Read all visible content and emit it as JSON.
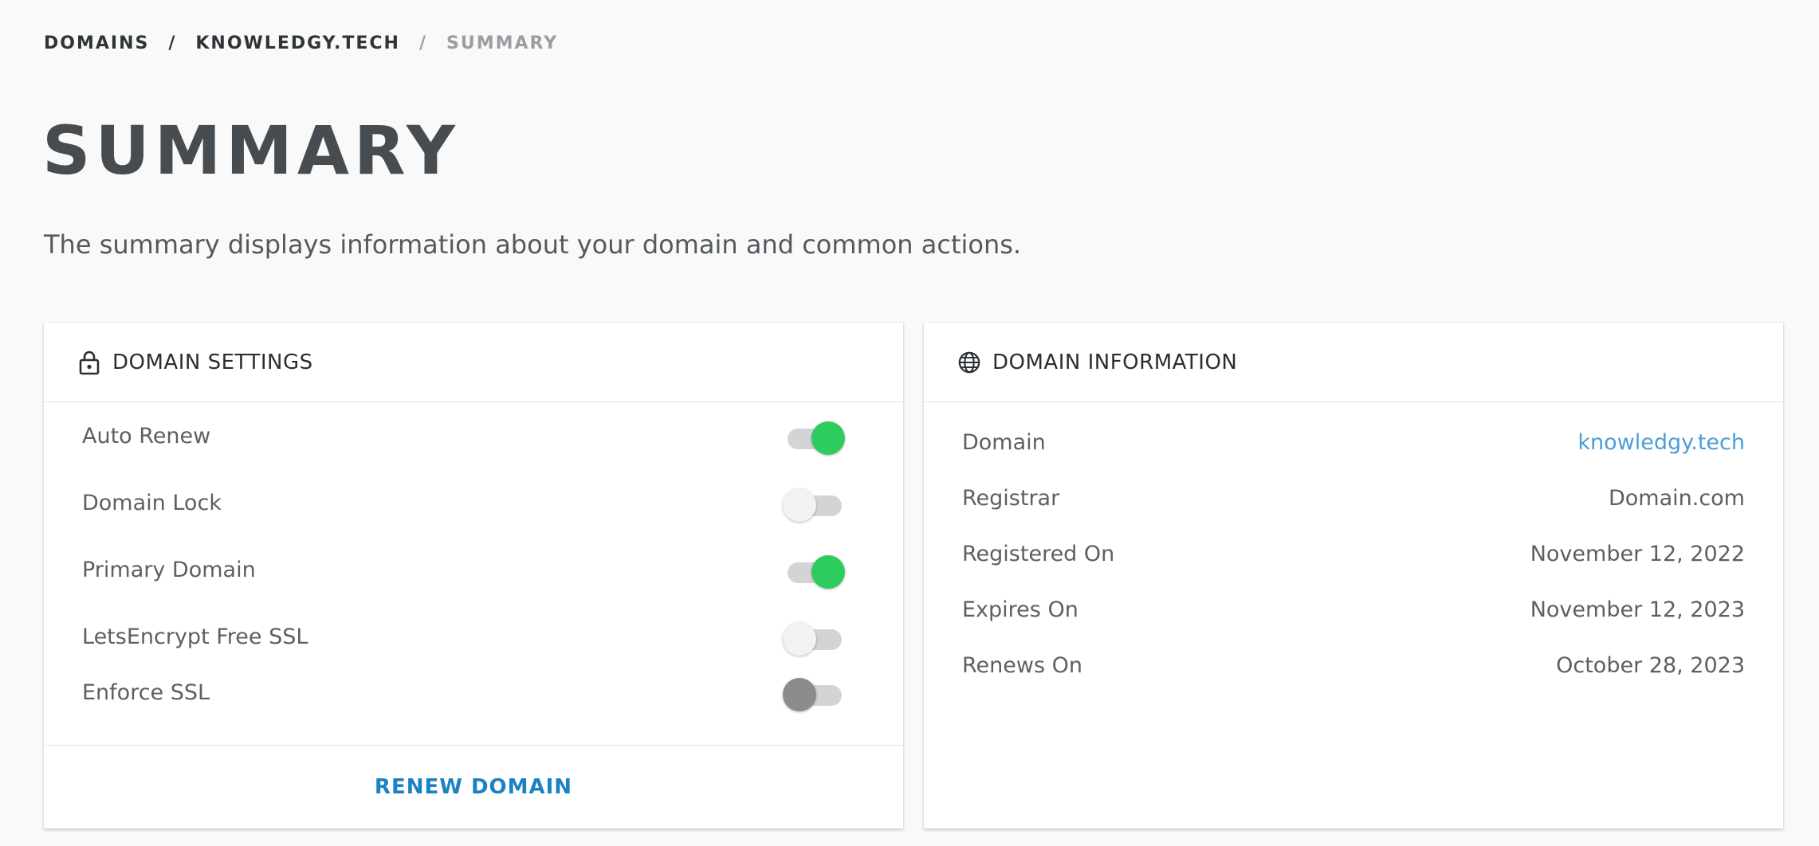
{
  "breadcrumb": {
    "items": [
      "DOMAINS",
      "KNOWLEDGY.TECH",
      "SUMMARY"
    ],
    "separator": "/"
  },
  "page": {
    "title": "SUMMARY",
    "subtitle": "The summary displays information about your domain and common actions."
  },
  "settings_card": {
    "title": "DOMAIN SETTINGS",
    "icon": "lock-icon",
    "rows": [
      {
        "label": "Auto Renew",
        "state": "on"
      },
      {
        "label": "Domain Lock",
        "state": "off"
      },
      {
        "label": "Primary Domain",
        "state": "on"
      },
      {
        "label": "LetsEncrypt Free SSL",
        "state": "off"
      },
      {
        "label": "Enforce SSL",
        "state": "disabled"
      }
    ],
    "renew_label": "RENEW DOMAIN"
  },
  "info_card": {
    "title": "DOMAIN INFORMATION",
    "icon": "globe-icon",
    "rows": [
      {
        "label": "Domain",
        "value": "knowledgy.tech",
        "is_link": true
      },
      {
        "label": "Registrar",
        "value": "Domain.com",
        "is_link": false
      },
      {
        "label": "Registered On",
        "value": "November 12, 2022",
        "is_link": false
      },
      {
        "label": "Expires On",
        "value": "November 12, 2023",
        "is_link": false
      },
      {
        "label": "Renews On",
        "value": "October 28, 2023",
        "is_link": false
      }
    ]
  },
  "colors": {
    "toggle_on": "#2ecc5f",
    "toggle_off_knob": "#f2f2f2",
    "toggle_disabled_knob": "#8c8c8c",
    "link": "#4a9fd6",
    "action": "#1a82c4"
  }
}
